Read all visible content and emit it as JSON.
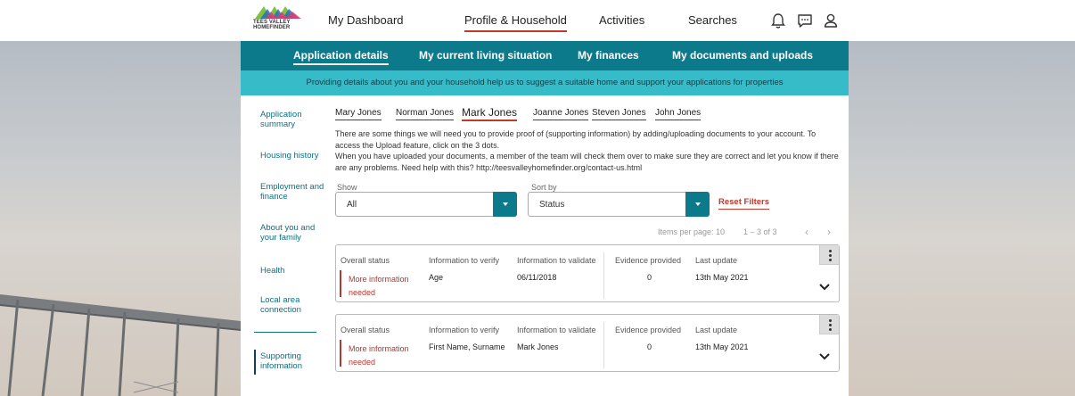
{
  "logo": {
    "line1": "TEES VALLEY",
    "line2": "HOMEFINDER"
  },
  "nav": {
    "items": [
      "My Dashboard",
      "Profile & Household",
      "Activities",
      "Searches"
    ],
    "active": "Profile & Household"
  },
  "subnav": {
    "items": [
      "Application details",
      "My current living situation",
      "My finances",
      "My documents and uploads"
    ]
  },
  "info_bar": "Providing details about you and your household help us to suggest a suitable home and support your applications for properties",
  "sidebar": {
    "items": [
      {
        "label": "Application summary"
      },
      {
        "label": "Housing history"
      },
      {
        "label": "Employment and finance"
      },
      {
        "label": "About you and your family"
      },
      {
        "label": "Health"
      },
      {
        "label": "Local area connection"
      },
      {
        "label": "Supporting information"
      }
    ]
  },
  "people": [
    "Mary Jones",
    "Norman Jones",
    "Mark Jones",
    "Joanne Jones",
    "Steven Jones",
    "John Jones"
  ],
  "intro": {
    "p1": "There are some things we will need you to provide proof of (supporting information) by adding/uploading documents to your account. To access the Upload feature, click on the 3 dots.",
    "p2": "When you have uploaded your documents, a member of the team will check them over to make sure they are correct and let you know if there are any problems. Need help with this? http://teesvalleyhomefinder.org/contact-us.html"
  },
  "filters": {
    "show_label": "Show",
    "show_value": "All",
    "sort_label": "Sort by",
    "sort_value": "Status",
    "reset": "Reset Filters"
  },
  "pager": {
    "items_per_page": "Items per page: 10",
    "range": "1 – 3 of 3"
  },
  "columns": [
    "Overall status",
    "Information to verify",
    "Information to validate",
    "Evidence provided",
    "Last update"
  ],
  "rows": [
    {
      "status": "More information needed",
      "verify": "Age",
      "validate": "06/11/2018",
      "evidence": "0",
      "updated": "13th May 2021"
    },
    {
      "status": "More information needed",
      "verify": "First Name, Surname",
      "validate": "Mark Jones",
      "evidence": "0",
      "updated": "13th May 2021"
    }
  ],
  "colors": {
    "teal": "#0d7a8c",
    "light_teal": "#36bcc8",
    "accent_red": "#c0392b"
  },
  "icons": [
    "bell-icon",
    "chat-icon",
    "user-icon",
    "dropdown-arrow-icon",
    "kebab-menu-icon",
    "chevron-down-icon",
    "chevron-left-icon",
    "chevron-right-icon"
  ]
}
